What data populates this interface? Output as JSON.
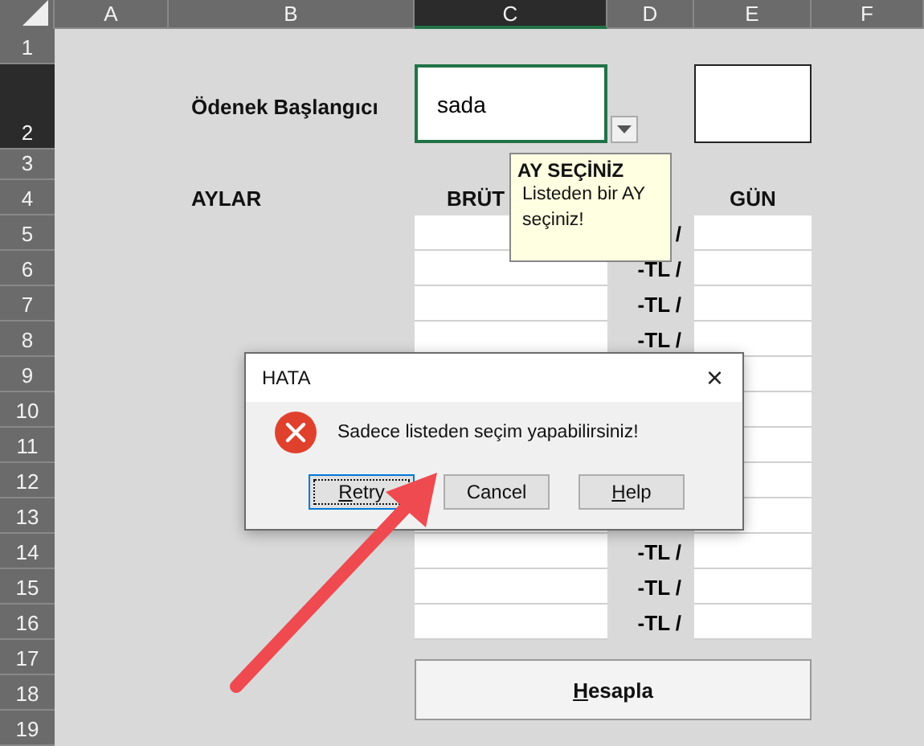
{
  "sheet": {
    "columns": [
      {
        "label": "A",
        "selected": false
      },
      {
        "label": "B",
        "selected": false
      },
      {
        "label": "C",
        "selected": true
      },
      {
        "label": "D",
        "selected": false
      },
      {
        "label": "E",
        "selected": false
      },
      {
        "label": "F",
        "selected": false
      }
    ],
    "rows": [
      {
        "label": "1",
        "selected": false
      },
      {
        "label": "2",
        "selected": true
      },
      {
        "label": "3",
        "selected": false
      },
      {
        "label": "4",
        "selected": false
      },
      {
        "label": "5",
        "selected": false
      },
      {
        "label": "6",
        "selected": false
      },
      {
        "label": "7",
        "selected": false
      },
      {
        "label": "8",
        "selected": false
      },
      {
        "label": "9",
        "selected": false
      },
      {
        "label": "10",
        "selected": false
      },
      {
        "label": "11",
        "selected": false
      },
      {
        "label": "12",
        "selected": false
      },
      {
        "label": "13",
        "selected": false
      },
      {
        "label": "14",
        "selected": false
      },
      {
        "label": "15",
        "selected": false
      },
      {
        "label": "16",
        "selected": false
      },
      {
        "label": "17",
        "selected": false
      },
      {
        "label": "18",
        "selected": false
      },
      {
        "label": "19",
        "selected": false
      }
    ]
  },
  "form": {
    "start_label": "Ödenek Başlangıcı",
    "start_value": "sada",
    "month_header": "AYLAR",
    "gross_header": "BRÜT",
    "day_header": "GÜN",
    "table_rows": [
      {
        "kind": "full",
        "unit": "/"
      },
      {
        "kind": "full",
        "unit": "-TL /"
      },
      {
        "kind": "full",
        "unit": "-TL /"
      },
      {
        "kind": "full",
        "unit": "-TL /"
      },
      {
        "kind": "day_only"
      },
      {
        "kind": "day_only"
      },
      {
        "kind": "day_only"
      },
      {
        "kind": "day_only"
      },
      {
        "kind": "full"
      },
      {
        "kind": "full",
        "unit": "-TL /"
      },
      {
        "kind": "full",
        "unit": "-TL /"
      },
      {
        "kind": "full",
        "unit": "-TL /"
      }
    ],
    "calculate_button": "Hesapla"
  },
  "tooltip": {
    "title": "AY SEÇİNİZ",
    "text": "Listeden bir AY seçiniz!"
  },
  "dialog": {
    "title": "HATA",
    "close": "×",
    "message": "Sadece listeden seçim yapabilirsiniz!",
    "buttons": [
      {
        "label": "Retry",
        "focused": true,
        "mnemonic": true
      },
      {
        "label": "Cancel",
        "focused": false,
        "mnemonic": false
      },
      {
        "label": "Help",
        "focused": false,
        "mnemonic": true
      }
    ]
  }
}
